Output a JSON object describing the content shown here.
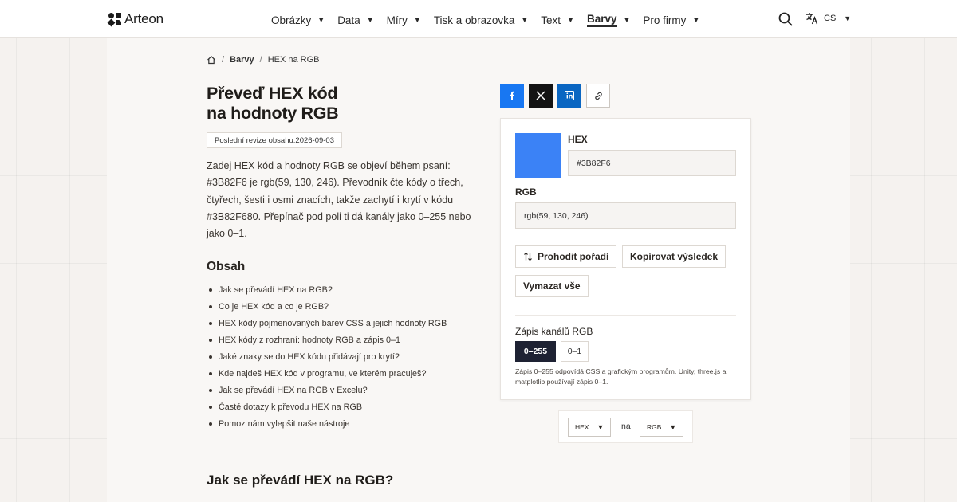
{
  "header": {
    "brand": "Arteon",
    "nav": [
      {
        "label": "Obrázky",
        "active": false
      },
      {
        "label": "Data",
        "active": false
      },
      {
        "label": "Míry",
        "active": false
      },
      {
        "label": "Tisk a obrazovka",
        "active": false
      },
      {
        "label": "Text",
        "active": false
      },
      {
        "label": "Barvy",
        "active": true
      },
      {
        "label": "Pro firmy",
        "active": false
      }
    ],
    "lang": "CS",
    "icons": {
      "search": "search-icon",
      "translate": "translate-icon",
      "caret": "caret-down-icon"
    }
  },
  "breadcrumb": {
    "section": "Barvy",
    "current": "HEX na RGB"
  },
  "article": {
    "title_line1": "Převeď HEX kód",
    "title_line2": "na hodnoty RGB",
    "revision_label": "Poslední revize obsahu:",
    "revision_date": "2026-09-03",
    "intro_lines": [
      "Zadej HEX kód a hodnoty RGB se objeví během psaní:",
      "#3B82F6 je rgb(59, 130, 246). Převodník čte kódy o třech,",
      "čtyřech, šesti i osmi znacích, takže zachytí i krytí v kódu",
      "#3B82F680. Přepínač pod poli ti dá kanály jako 0–255 nebo",
      "jako 0–1."
    ],
    "toc_heading": "Obsah",
    "toc": [
      "Jak se převádí HEX na RGB?",
      "Co je HEX kód a co je RGB?",
      "HEX kódy pojmenovaných barev CSS a jejich hodnoty RGB",
      "HEX kódy z rozhraní: hodnoty RGB a zápis 0–1",
      "Jaké znaky se do HEX kódu přidávají pro krytí?",
      "Kde najdeš HEX kód v programu, ve kterém pracuješ?",
      "Jak se převádí HEX na RGB v Excelu?",
      "Časté dotazy k převodu HEX na RGB",
      "Pomoz nám vylepšit naše nástroje"
    ],
    "section_heading": "Jak se převádí HEX na RGB?"
  },
  "share": {
    "icons": [
      "facebook-icon",
      "x-icon",
      "linkedin-icon",
      "link-icon"
    ]
  },
  "converter": {
    "swatch_color": "#3B82F6",
    "hex_label": "HEX",
    "hex_value": "#3B82F6",
    "rgb_label": "RGB",
    "rgb_value": "rgb(59, 130, 246)",
    "swap_label": "Prohodit pořadí",
    "copy_label": "Kopírovat výsledek",
    "clear_label": "Vymazat vše",
    "channels_label": "Zápis kanálů RGB",
    "option_255": "0–255",
    "option_1": "0–1",
    "selected_option": "0–255",
    "hint": "Zápis 0–255 odpovídá CSS a grafickým programům. Unity, three.js a matplotlib používají zápis 0–1."
  },
  "format_switch": {
    "from": "HEX",
    "connector": "na",
    "to": "RGB"
  },
  "colors": {
    "accent": "#1e2233",
    "facebook": "#1877f2",
    "x": "#141414",
    "linkedin": "#0a66c2"
  }
}
